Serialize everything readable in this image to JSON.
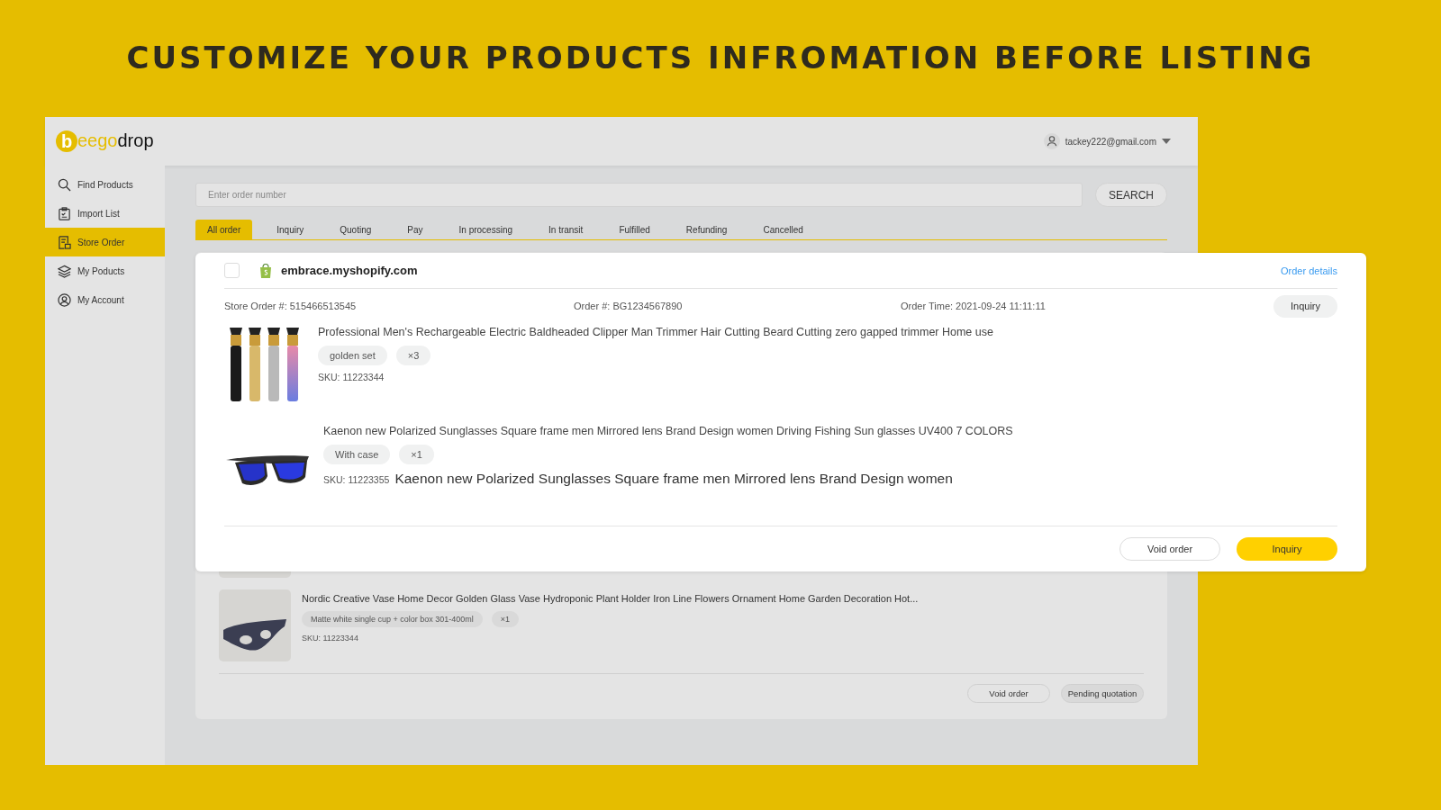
{
  "headline": "CUSTOMIZE YOUR PRODUCTS INFROMATION BEFORE LISTING",
  "logo": [
    {
      "text": "b",
      "kind": "badge"
    },
    {
      "text": "eego",
      "kind": "accent"
    },
    {
      "text": "drop",
      "kind": "plain"
    }
  ],
  "account": {
    "email": "tackey222@gmail.com"
  },
  "sidebar": {
    "items": [
      {
        "label": "Find Products",
        "kind": "search",
        "selected": false
      },
      {
        "label": "Import List",
        "kind": "clipboard",
        "selected": false
      },
      {
        "label": "Store Order",
        "kind": "receipt",
        "selected": true
      },
      {
        "label": "My Poducts",
        "kind": "layers",
        "selected": false
      },
      {
        "label": "My Account",
        "kind": "person",
        "selected": false
      }
    ]
  },
  "search": {
    "placeholder": "Enter order number",
    "button": "SEARCH"
  },
  "tabs": [
    {
      "label": "All order",
      "selected": true
    },
    {
      "label": "Inquiry",
      "selected": false
    },
    {
      "label": "Quoting",
      "selected": false
    },
    {
      "label": "Pay",
      "selected": false
    },
    {
      "label": "In processing",
      "selected": false
    },
    {
      "label": "In transit",
      "selected": false
    },
    {
      "label": "Fulfilled",
      "selected": false
    },
    {
      "label": "Refunding",
      "selected": false
    },
    {
      "label": "Cancelled",
      "selected": false
    }
  ],
  "background_order": {
    "items": [
      {
        "title": "Nordic Creative Vase Home Decor Golden Glass Vase Hydroponic Plant Holder Iron Line Flowers Ornament Home Garden Decoration Hot...",
        "variant": "Matte white single cup + color box 301-400ml",
        "quantity": "×1",
        "sku": "SKU: 11223344"
      }
    ],
    "buttons": [
      "Void order",
      "Pending quotation"
    ]
  },
  "order_card": {
    "checked": false,
    "store": "embrace.myshopify.com",
    "details_link": "Order details",
    "store_order": "Store Order #: 515466513545",
    "order_no": "Order #: BG1234567890",
    "order_time": "Order Time: 2021-09-24 11:11:11",
    "status_button": "Inquiry",
    "items": [
      {
        "kind": "trimmer",
        "title": "Professional Men's Rechargeable Electric Baldheaded Clipper Man Trimmer Hair Cutting Beard Cutting zero gapped trimmer Home use",
        "variant": "golden set",
        "quantity": "×3",
        "sku": "SKU: 11223344"
      },
      {
        "kind": "sunglasses",
        "title": "Kaenon new Polarized Sunglasses Square frame men Mirrored lens Brand Design women Driving Fishing Sun glasses UV400 7 COLORS",
        "variant": "With case",
        "quantity": "×1",
        "sku": "SKU: 11223355",
        "caption": "Kaenon new Polarized Sunglasses Square frame men Mirrored lens Brand Design women"
      }
    ],
    "buttons": [
      {
        "label": "Void order",
        "kind": "outline"
      },
      {
        "label": "Inquiry",
        "kind": "primary"
      }
    ]
  }
}
